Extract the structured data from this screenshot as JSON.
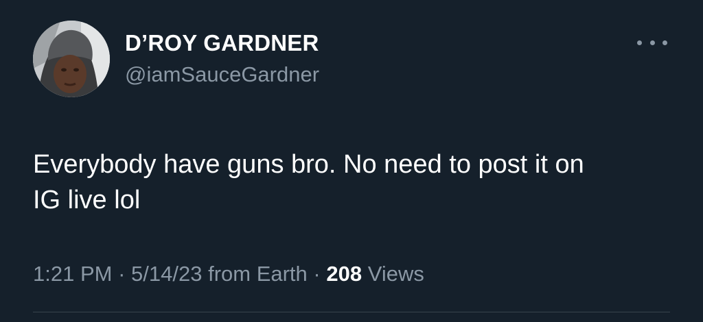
{
  "author": {
    "display_name": "D’ROY GARDNER",
    "handle": "@iamSauceGardner"
  },
  "tweet": {
    "text_line_1": "Everybody have guns bro. No need to post it on",
    "text_line_2": "IG live lol"
  },
  "meta": {
    "time": "1:21 PM",
    "separator": " · ",
    "date": "5/14/23",
    "source": "from Earth",
    "views_count": "208",
    "views_label": "Views"
  },
  "icons": {
    "more": "more-options-icon"
  },
  "colors": {
    "background": "#15202b",
    "primary_text": "#ffffff",
    "secondary_text": "#8b98a5",
    "divider": "#38444d"
  }
}
